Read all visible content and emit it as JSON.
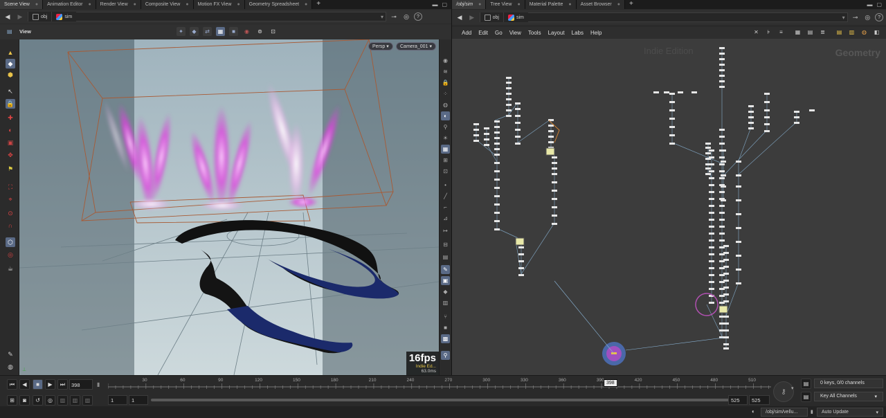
{
  "left_tabs": [
    {
      "label": "Scene View",
      "active": true
    },
    {
      "label": "Animation Editor",
      "active": false
    },
    {
      "label": "Render View",
      "active": false
    },
    {
      "label": "Composite View",
      "active": false
    },
    {
      "label": "Motion FX View",
      "active": false
    },
    {
      "label": "Geometry Spreadsheet",
      "active": false
    }
  ],
  "right_tabs": [
    {
      "label": "/obj/sim",
      "active": true
    },
    {
      "label": "Tree View",
      "active": false
    },
    {
      "label": "Material Palette",
      "active": false
    },
    {
      "label": "Asset Browser",
      "active": false
    }
  ],
  "left_path": {
    "level1": "obj",
    "level2": "sim"
  },
  "right_path": {
    "level1": "obj",
    "level2": "sim"
  },
  "viewer": {
    "title": "View",
    "persp_label": "Persp",
    "camera_label": "Camera_001",
    "fps": "16fps",
    "edition_note": "Indie Ed...",
    "time_ms": "63.0ms"
  },
  "network_menu": [
    "Add",
    "Edit",
    "Go",
    "View",
    "Tools",
    "Layout",
    "Labs",
    "Help"
  ],
  "network": {
    "edition_watermark": "Indie Edition",
    "context_watermark": "Geometry"
  },
  "playbar": {
    "current_frame": "398",
    "frame_marker": "398",
    "ticks": [
      "30",
      "60",
      "90",
      "120",
      "150",
      "180",
      "210",
      "240",
      "270",
      "300",
      "330",
      "360",
      "390",
      "420",
      "450",
      "480",
      "510"
    ],
    "start_a": "1",
    "start_b": "1",
    "end_a": "525",
    "end_b": "525",
    "keys_label": "0 keys, 0/0 channels",
    "key_all_label": "Key All Channels"
  },
  "status": {
    "path": "/obj/sim/vellu...",
    "update_mode": "Auto Update"
  },
  "colors": {
    "accent": "#5a6a86",
    "smoke": "#e040e0",
    "cloth": "#1b2a6b",
    "bbox": "#b0623a",
    "wire": "#8ab4d6"
  }
}
